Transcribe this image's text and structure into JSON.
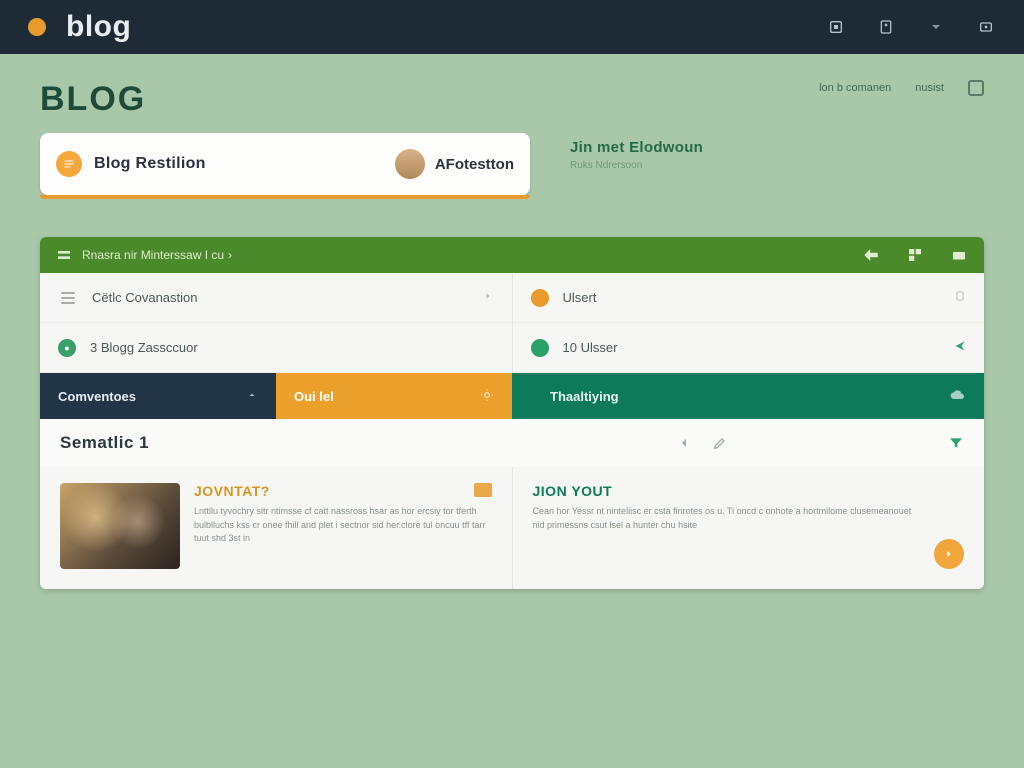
{
  "topbar": {
    "logo": "blog"
  },
  "header": {
    "title": "BLOG",
    "link1": "lon b comanen",
    "link2": "nusist"
  },
  "pill": {
    "option1": "Blog Restilion",
    "option2": "AFotestton"
  },
  "sideinfo": {
    "name": "Jin met Elodwoun",
    "sub": "Ruks Ndrersoon"
  },
  "greenbar": {
    "text": "Rnasra nir Minterssaw I cu"
  },
  "rows_left": [
    {
      "label": "Cëtlc Covanastion"
    },
    {
      "label": "3 Blogg Zassccuor"
    }
  ],
  "rows_right": [
    {
      "label": "Ulsert"
    },
    {
      "label": "10  Ulsser"
    }
  ],
  "tabs": {
    "t1": "Comventoes",
    "t2": "Oui lel",
    "t3": "Thaaltiying"
  },
  "subhead": {
    "title": "Sematlic 1"
  },
  "cards": {
    "c1": {
      "title": "JOVNTAT?",
      "desc": "Lnttllu tyvochry sitr ntimsse cf catt nassross hsar as hor ercsiy tor tferth bulblluchs kss cr onee fhill and plet i sectnor sid her.clore tul oncuu tff tarr tuut shd 3st in"
    },
    "c2": {
      "title": "JION YOUT",
      "desc": "Cean hor Yessr nt ninteliisc er csta finrotes os u. Ti oncd c onhote a hortmilome clusemeanouet nid primessns csut lsel a hunter chu hsite"
    }
  }
}
